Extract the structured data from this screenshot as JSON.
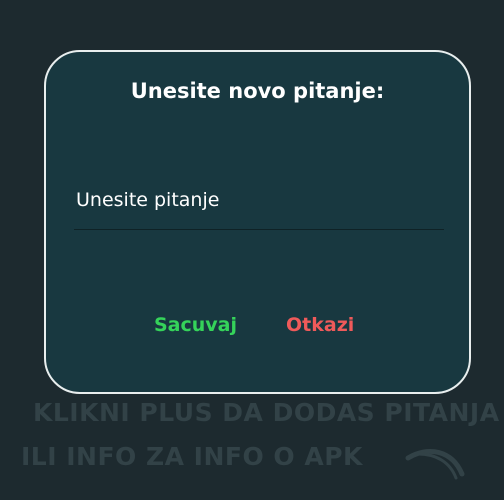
{
  "background": {
    "hint_line1": "KLIKNI PLUS DA DODAS PITANJA",
    "hint_line2": "ILI INFO ZA INFO O APK"
  },
  "dialog": {
    "title": "Unesite novo pitanje:",
    "input": {
      "placeholder": "Unesite pitanje",
      "value": ""
    },
    "save_label": "Sacuvaj",
    "cancel_label": "Otkazi"
  },
  "colors": {
    "background": "#1d2a2f",
    "dialog_bg": "#183840",
    "dialog_border": "#e8eeee",
    "save": "#35d35a",
    "cancel": "#ef5a5a",
    "hint_text": "#324247"
  }
}
